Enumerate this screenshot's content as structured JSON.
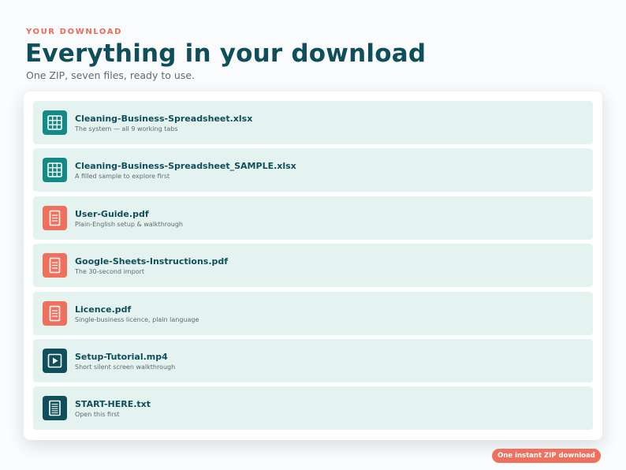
{
  "header": {
    "eyebrow": "YOUR DOWNLOAD",
    "title": "Everything in your download",
    "subtitle": "One ZIP, seven files, ready to use."
  },
  "files": [
    {
      "name": "Cleaning-Business-Spreadsheet.xlsx",
      "desc": "The system — all 9 working tabs",
      "icon": "spreadsheet-icon"
    },
    {
      "name": "Cleaning-Business-Spreadsheet_SAMPLE.xlsx",
      "desc": "A filled sample to explore first",
      "icon": "spreadsheet-icon"
    },
    {
      "name": "User-Guide.pdf",
      "desc": "Plain-English setup & walkthrough",
      "icon": "document-icon"
    },
    {
      "name": "Google-Sheets-Instructions.pdf",
      "desc": "The 30-second import",
      "icon": "document-icon"
    },
    {
      "name": "Licence.pdf",
      "desc": "Single-business licence, plain language",
      "icon": "document-icon"
    },
    {
      "name": "Setup-Tutorial.mp4",
      "desc": "Short silent screen walkthrough",
      "icon": "video-icon"
    },
    {
      "name": "START-HERE.txt",
      "desc": "Open this first",
      "icon": "text-file-icon"
    }
  ],
  "footer": {
    "badge": "One instant ZIP download"
  },
  "colors": {
    "brand_dark": "#0f4e5b",
    "brand_teal": "#148a86",
    "accent_coral": "#f0705e",
    "row_background": "#e5f3f0"
  }
}
